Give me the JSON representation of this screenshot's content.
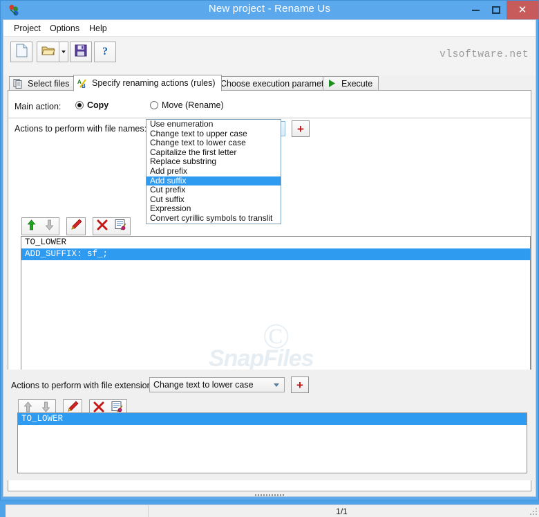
{
  "window": {
    "title": "New project - Rename Us",
    "app_icon": "app-icon",
    "minimize_label": "–",
    "maximize_label": "□",
    "close_label": "✕",
    "titlebar_color": "#5BA9EC",
    "close_button_color": "#C75B5B"
  },
  "menubar": {
    "items": [
      {
        "label": "Project"
      },
      {
        "label": "Options"
      },
      {
        "label": "Help"
      }
    ]
  },
  "toolbar": {
    "buttons": [
      {
        "name": "new-project-button",
        "icon": "new-document-icon"
      },
      {
        "name": "open-project-button",
        "icon": "open-folder-icon"
      },
      {
        "name": "open-dropdown-button",
        "icon": "chevron-down-icon"
      },
      {
        "name": "save-project-button",
        "icon": "floppy-disk-icon"
      },
      {
        "name": "help-button",
        "icon": "question-mark-icon"
      }
    ],
    "brand": "vlsoftware.net"
  },
  "tabs": [
    {
      "label": "Select files",
      "icon": "files-icon",
      "active": false
    },
    {
      "label": "Specify renaming actions (rules)",
      "icon": "ab-letters-icon",
      "active": true
    },
    {
      "label": "Choose execution parameters",
      "icon": "parameters-icon",
      "active": false
    },
    {
      "label": "Execute",
      "icon": "play-triangle-icon",
      "active": false
    }
  ],
  "main_action": {
    "label": "Main action:",
    "options": [
      {
        "label": "Copy",
        "selected": true
      },
      {
        "label": "Move (Rename)",
        "selected": false
      }
    ]
  },
  "names_section": {
    "label": "Actions to perform with file names:",
    "combo_value": "Add suffix",
    "add_button_label": "+",
    "action_buttons": [
      {
        "name": "move-up-button",
        "icon": "arrow-up-icon"
      },
      {
        "name": "move-down-button",
        "icon": "arrow-down-icon"
      },
      {
        "name": "edit-rule-button",
        "icon": "pen-icon"
      },
      {
        "name": "delete-rule-button",
        "icon": "red-x-icon"
      },
      {
        "name": "edit-properties-button",
        "icon": "edit-document-icon"
      }
    ],
    "rules": [
      {
        "text": "TO_LOWER",
        "selected": false
      },
      {
        "text": "ADD_SUFFIX: sf_;",
        "selected": true
      }
    ]
  },
  "dropdown": {
    "open": true,
    "items": [
      {
        "label": "Use enumeration",
        "selected": false
      },
      {
        "label": "Change text to upper case",
        "selected": false
      },
      {
        "label": "Change text to lower case",
        "selected": false
      },
      {
        "label": "Capitalize the first letter",
        "selected": false
      },
      {
        "label": "Replace substring",
        "selected": false
      },
      {
        "label": "Add prefix",
        "selected": false
      },
      {
        "label": "Add suffix",
        "selected": true
      },
      {
        "label": "Cut prefix",
        "selected": false
      },
      {
        "label": "Cut suffix",
        "selected": false
      },
      {
        "label": "Expression",
        "selected": false
      },
      {
        "label": "Convert cyrillic symbols to translit",
        "selected": false
      }
    ]
  },
  "extensions_section": {
    "label": "Actions to perform with file extensions:",
    "combo_value": "Change text to lower case",
    "add_button_label": "+",
    "action_buttons": [
      {
        "name": "move-up-button",
        "icon": "arrow-up-icon"
      },
      {
        "name": "move-down-button",
        "icon": "arrow-down-icon"
      },
      {
        "name": "edit-rule-button",
        "icon": "pen-icon"
      },
      {
        "name": "delete-rule-button",
        "icon": "red-x-icon"
      },
      {
        "name": "edit-properties-button",
        "icon": "edit-document-icon"
      }
    ],
    "rules": [
      {
        "text": "TO_LOWER",
        "selected": true
      }
    ]
  },
  "watermark": {
    "copyright_glyph": "©",
    "text": "SnapFiles"
  },
  "statusbar": {
    "pane1": "",
    "pane2": "1/1"
  },
  "colors": {
    "selection_blue": "#2F9BF0",
    "titlebar_blue": "#5BA9EC",
    "close_red": "#C75B5B",
    "plus_red": "#C01818"
  }
}
